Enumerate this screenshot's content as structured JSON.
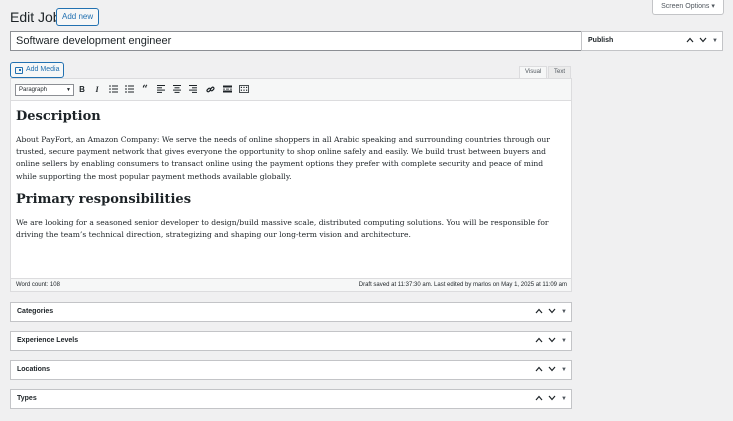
{
  "header": {
    "title": "Edit Job",
    "add_new_label": "Add new",
    "screen_options_label": "Screen Options ▾"
  },
  "post": {
    "title_value": "Software development engineer"
  },
  "publish_box": {
    "label": "Publish"
  },
  "editor": {
    "add_media_label": "Add Media",
    "tabs": {
      "visual": "Visual",
      "text": "Text"
    },
    "format_select": "Paragraph",
    "toolbar_icons": [
      "bold-icon",
      "italic-icon",
      "bulleted-list-icon",
      "numbered-list-icon",
      "blockquote-icon",
      "align-left-icon",
      "align-center-icon",
      "align-right-icon",
      "link-icon",
      "read-more-icon",
      "toolbar-toggle-icon"
    ],
    "content": {
      "heading1": "Description",
      "paragraph1": "About PayFort, an Amazon Company: We serve the needs of online shoppers in all Arabic speaking and surrounding countries through our trusted, secure payment network that gives everyone the opportunity to shop online safely and easily. We build trust between buyers and online sellers by enabling consumers to transact online using the payment options they prefer with complete security and peace of mind while supporting the most popular payment methods available globally.",
      "heading2": "Primary responsibilities",
      "paragraph2": "We are looking for a seasoned senior developer to design/build massive scale, distributed computing solutions. You will be responsible for driving the team’s technical direction, strategizing and shaping our long-term vision and architecture."
    },
    "status": {
      "word_count": "Word count: 108",
      "draft_status": "Draft saved at 11:37:30 am. Last edited by marlos on May 1, 2025 at 11:09 am"
    }
  },
  "meta_boxes": {
    "categories": "Categories",
    "experience_levels": "Experience Levels",
    "locations": "Locations",
    "types": "Types"
  },
  "controls": {
    "up": "⌃",
    "down": "⌄",
    "toggle": "▼"
  },
  "colors": {
    "accent": "#2271b1",
    "background": "#f0f0f1",
    "border": "#c3c4c7"
  }
}
